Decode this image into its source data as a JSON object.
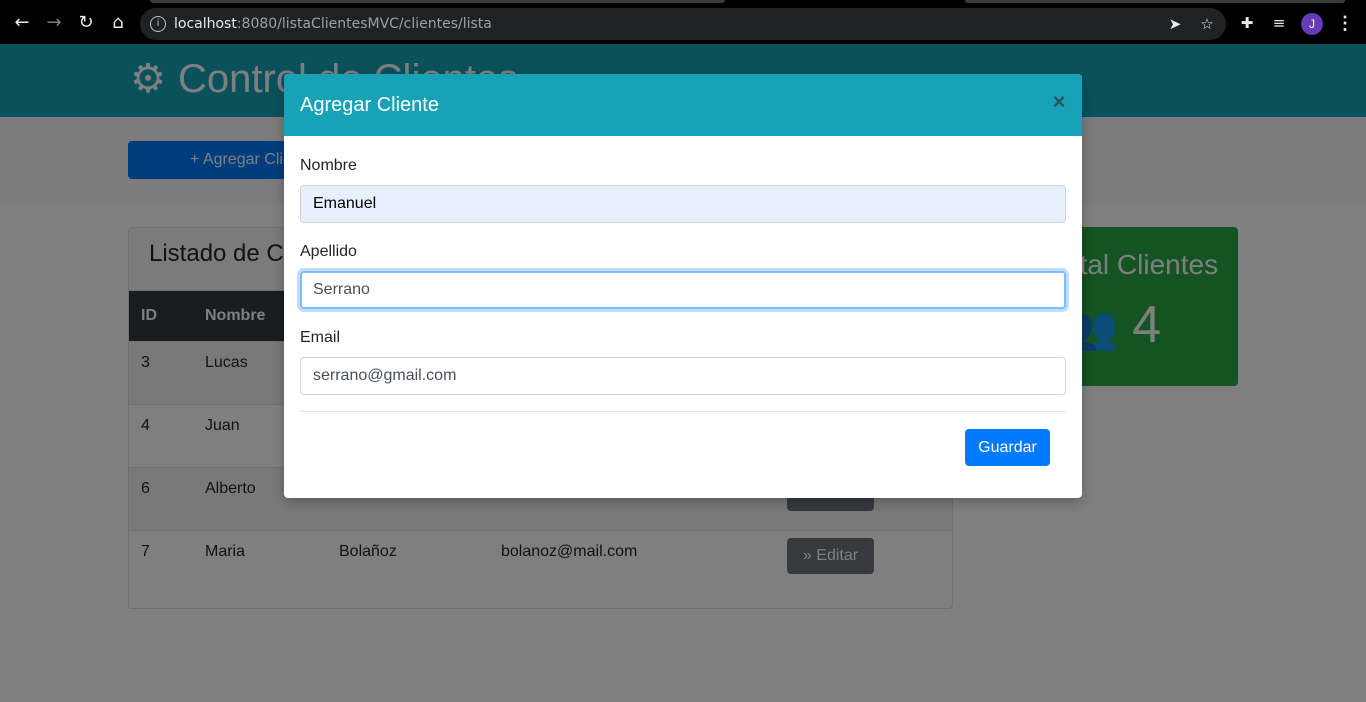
{
  "browser": {
    "url_host": "localhost",
    "url_rest": ":8080/listaClientesMVC/clientes/lista",
    "profile_initial": "J"
  },
  "page": {
    "title": "Control de Clientes",
    "add_button_label": "Agregar Cliente",
    "list_title": "Listado de Clientes",
    "columns": [
      "ID",
      "Nombre"
    ],
    "rows": [
      {
        "id": "3",
        "nombre": "Lucas"
      },
      {
        "id": "4",
        "nombre": "Juan"
      },
      {
        "id": "6",
        "nombre": "Alberto"
      },
      {
        "id": "7",
        "nombre": "Maria",
        "apellido": "Bolañoz",
        "email": "bolanoz@mail.com"
      }
    ],
    "edit_label": "Editar",
    "total_title": "Total Clientes",
    "total_count": "4"
  },
  "modal": {
    "title": "Agregar Cliente",
    "close_glyph": "×",
    "fields": [
      {
        "label": "Nombre",
        "value": "Emanuel"
      },
      {
        "label": "Apellido",
        "value": "Serrano"
      },
      {
        "label": "Email",
        "value": "serrano@gmail.com"
      }
    ],
    "save_label": "Guardar"
  },
  "colors": {
    "header_teal": "#17a2b8",
    "primary_blue": "#007bff",
    "success_green": "#28a745",
    "table_dark": "#343a40",
    "edit_gray": "#6c757d"
  }
}
